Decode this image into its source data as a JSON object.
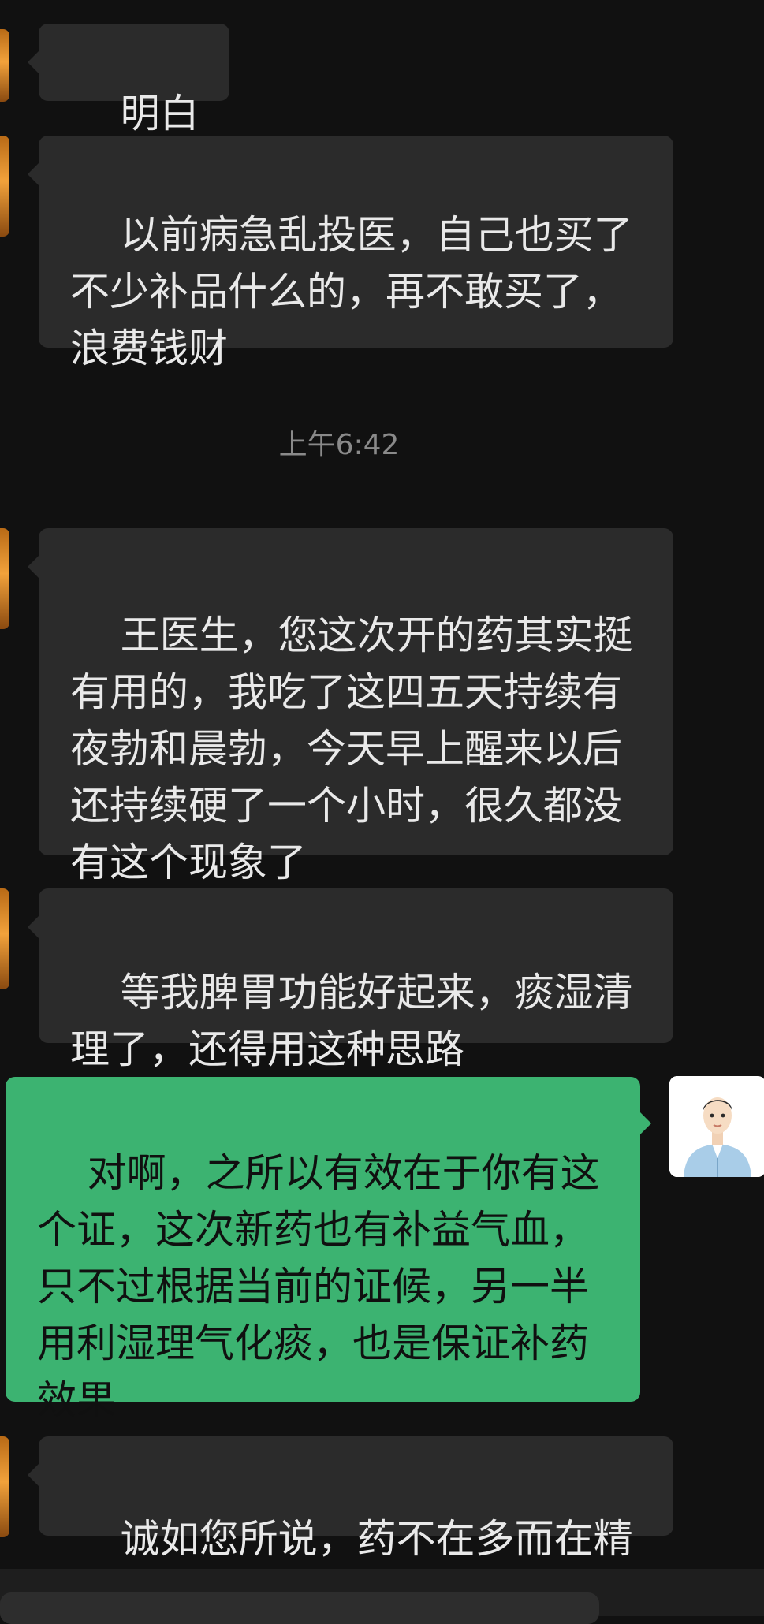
{
  "timestamp": "上午6:42",
  "messages": [
    {
      "from": "other",
      "text": "明白了"
    },
    {
      "from": "other",
      "text": "以前病急乱投医，自己也买了不少补品什么的，再不敢买了，浪费钱财"
    },
    {
      "from": "other",
      "text": "王医生，您这次开的药其实挺有用的，我吃了这四五天持续有夜勃和晨勃，今天早上醒来以后还持续硬了一个小时，很久都没有这个现象了"
    },
    {
      "from": "other",
      "text": "等我脾胃功能好起来，痰湿清理了，还得用这种思路"
    },
    {
      "from": "self",
      "text": "对啊，之所以有效在于你有这个证，这次新药也有补益气血，只不过根据当前的证候，另一半用利湿理气化痰，也是保证补药效果"
    },
    {
      "from": "other",
      "text": "诚如您所说，药不在多而在精"
    }
  ],
  "colors": {
    "background": "#111111",
    "incoming_bubble": "#2b2b2b",
    "outgoing_bubble": "#3cb371"
  }
}
